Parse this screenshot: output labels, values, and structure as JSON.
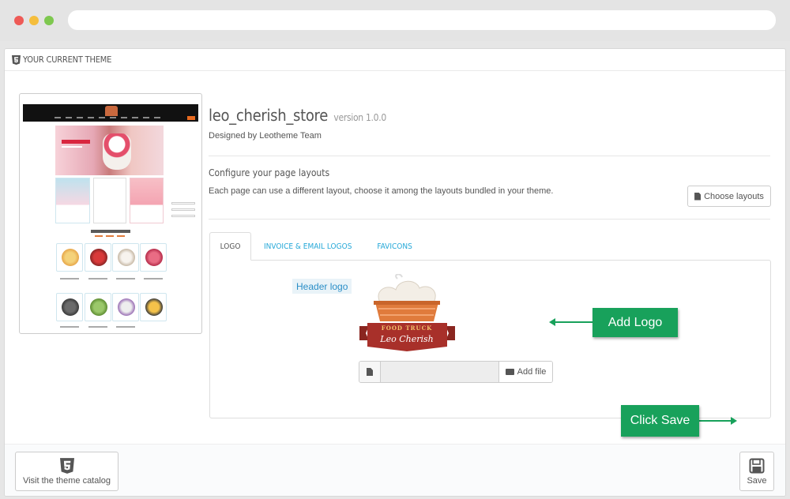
{
  "panel": {
    "heading": "YOUR CURRENT THEME",
    "heading_icon": "html5-icon"
  },
  "theme": {
    "name": "leo_cherish_store",
    "version": "version 1.0.0",
    "designed_by": "Designed by Leotheme Team"
  },
  "layouts": {
    "title": "Configure your page layouts",
    "description": "Each page can use a different layout, choose it among the layouts bundled in your theme.",
    "button": "Choose layouts"
  },
  "tabs": [
    {
      "label": "LOGO",
      "active": true
    },
    {
      "label": "INVOICE & EMAIL LOGOS",
      "active": false
    },
    {
      "label": "FAVICONS",
      "active": false
    }
  ],
  "logo_tab": {
    "header_logo_label": "Header logo",
    "logo_text_top": "FOOD TRUCK",
    "logo_text_main": "Leo Cherish",
    "add_file": "Add file"
  },
  "footer": {
    "catalog_button": "Visit the theme catalog",
    "save_button": "Save"
  },
  "annotations": {
    "add_logo": "Add Logo",
    "click_save": "Click Save",
    "color": "#18a15b"
  },
  "colors": {
    "link": "#25a8d8",
    "label_bg": "#e9f3f8",
    "logo_ribbon": "#a8302a",
    "logo_basket": "#e07b3c"
  }
}
